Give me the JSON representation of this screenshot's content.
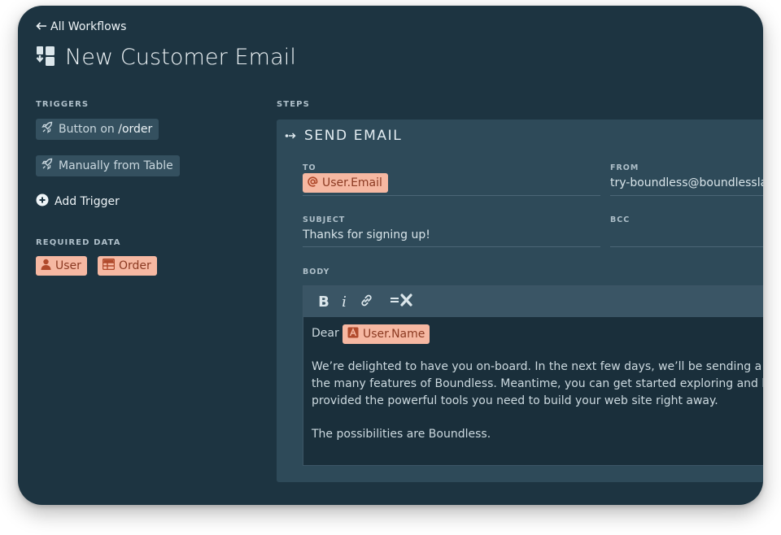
{
  "nav": {
    "back_label": "All Workflows"
  },
  "page": {
    "title": "New Customer Email"
  },
  "triggers": {
    "label": "TRIGGERS",
    "items": [
      {
        "prefix": "Button on ",
        "emph": "/order"
      },
      {
        "prefix": "Manually from Table",
        "emph": ""
      }
    ],
    "add_label": "Add Trigger"
  },
  "required_data": {
    "label": "REQUIRED DATA",
    "items": [
      "User",
      "Order"
    ]
  },
  "steps": {
    "label": "STEPS"
  },
  "step": {
    "title": "SEND EMAIL",
    "to_label": "TO",
    "to_value": "User.Email",
    "from_label": "FROM",
    "from_value": "try-boundless@boundlessla",
    "subject_label": "SUBJECT",
    "subject_value": "Thanks for signing up!",
    "bcc_label": "BCC",
    "bcc_value": "",
    "body_label": "BODY",
    "toolbar": {
      "bold": "B",
      "italic": "i"
    },
    "body": {
      "greeting": "Dear",
      "variable": "User.Name",
      "line1": "We’re delighted to have you on-board. In the next few days, we’ll be sending a series",
      "line2": "the many features of Boundless. Meantime, you can get started exploring and build",
      "line3": "provided the powerful tools you need to build your web site right away.",
      "line4": "The possibilities are Boundless."
    }
  },
  "colors": {
    "background": "#1d3441",
    "card": "#2e4a59",
    "chip": "#f6b8a2",
    "chip_text": "#8b3a22",
    "trigger_bg": "#34505f"
  },
  "icons": [
    "left-arrow-icon",
    "workflow-icon",
    "rocket-icon",
    "plus-circle-icon",
    "user-icon",
    "table-icon",
    "step-arrow-icon",
    "at-icon",
    "link-icon",
    "clear-format-icon",
    "text-variable-icon"
  ]
}
